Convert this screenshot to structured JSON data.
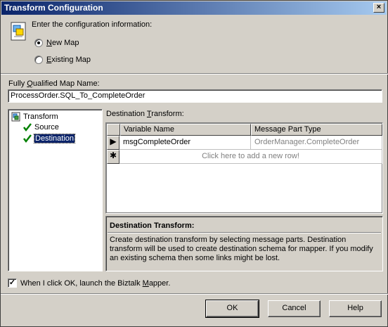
{
  "window": {
    "title": "Transform Configuration",
    "close_glyph": "×"
  },
  "header": {
    "label": "Enter the configuration information:",
    "icon": "wizard-icon"
  },
  "options": {
    "new_map": {
      "accel": "N",
      "rest": "ew Map",
      "checked": true
    },
    "existing_map": {
      "accel": "E",
      "rest": "xisting Map",
      "checked": false
    }
  },
  "map_name": {
    "label_pre": "Fully ",
    "label_accel": "Q",
    "label_post": "ualified Map Name:",
    "value": "ProcessOrder.SQL_To_CompleteOrder"
  },
  "tree": {
    "root": "Transform",
    "children": [
      {
        "label": "Source",
        "selected": false
      },
      {
        "label": "Destination",
        "selected": true
      }
    ]
  },
  "destination": {
    "label_pre": "Destination ",
    "label_accel": "T",
    "label_post": "ransform:",
    "columns": [
      "Variable Name",
      "Message Part Type"
    ],
    "rows": [
      {
        "marker": "▶",
        "variable": "msgCompleteOrder",
        "type": "OrderManager.CompleteOrder"
      }
    ],
    "new_row": {
      "marker": "✱",
      "text": "Click here to add a new row!"
    }
  },
  "description": {
    "title": "Destination Transform:",
    "text": "Create destination transform by selecting message parts. Destination transform will be used to create destination schema for mapper. If you modify an existing schema then some links might be lost."
  },
  "launch": {
    "checked": true,
    "label_pre": "When I click OK, launch the Biztalk ",
    "label_accel": "M",
    "label_post": "apper."
  },
  "buttons": {
    "ok": "OK",
    "cancel": "Cancel",
    "help": "Help"
  },
  "colors": {
    "title_start": "#0a246a",
    "title_end": "#a6caf0",
    "face": "#d4d0c8",
    "selection": "#0a246a",
    "check_green": "#008000"
  }
}
